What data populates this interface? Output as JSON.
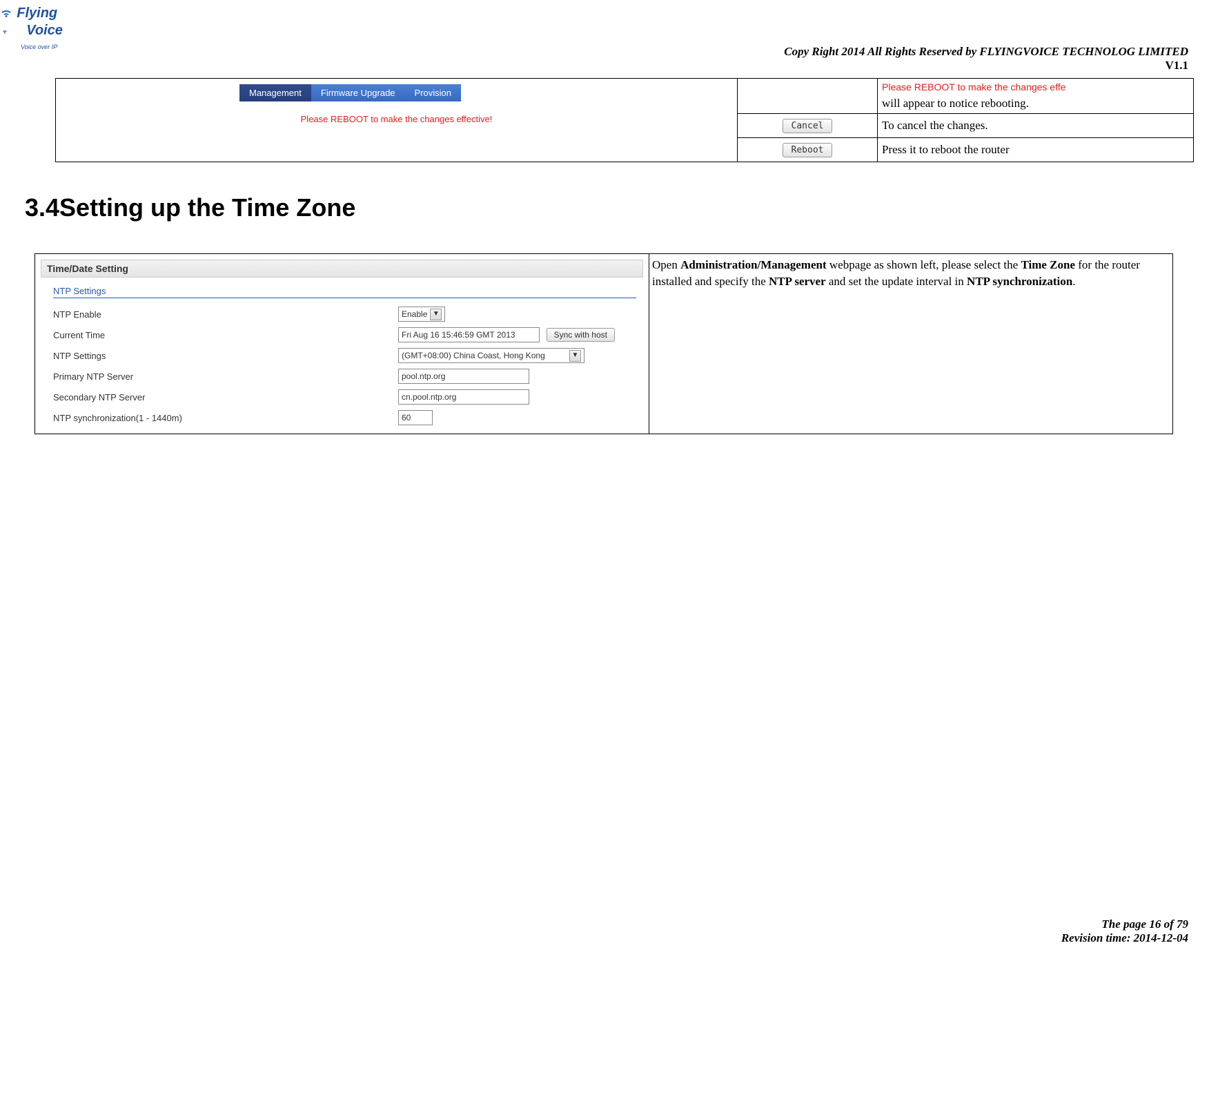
{
  "logo": {
    "flying": "Flying",
    "voice": "Voice",
    "tag": "Voice over IP"
  },
  "header": {
    "copyright": "Copy Right 2014 All Rights Reserved by FLYINGVOICE TECHNOLOG LIMITED",
    "version": "V1.1"
  },
  "top_table": {
    "tabs": {
      "management": "Management",
      "firmware": "Firmware Upgrade",
      "provision": "Provision"
    },
    "reboot_msg_full": "Please REBOOT to make the changes effective!",
    "reboot_msg_trunc": "Please REBOOT to make the changes effe",
    "appear_line": " will appear to notice rebooting.",
    "cancel_btn": "Cancel",
    "cancel_desc": "To cancel the changes.",
    "reboot_btn": "Reboot",
    "reboot_desc": "Press it to reboot the router"
  },
  "section_heading": "3.4Setting up the Time Zone",
  "tz_panel": {
    "title": "Time/Date Setting",
    "section": "NTP Settings",
    "rows": {
      "ntp_enable_label": "NTP Enable",
      "ntp_enable_value": "Enable",
      "current_time_label": "Current Time",
      "current_time_value": "Fri Aug 16 15:46:59 GMT 2013",
      "sync_btn": "Sync with host",
      "ntp_settings_label": "NTP Settings",
      "ntp_settings_value": "(GMT+08:00) China Coast, Hong Kong",
      "primary_label": "Primary NTP Server",
      "primary_value": "pool.ntp.org",
      "secondary_label": "Secondary NTP Server",
      "secondary_value": "cn.pool.ntp.org",
      "sync_interval_label": "NTP synchronization(1 - 1440m)",
      "sync_interval_value": "60"
    }
  },
  "tz_desc": {
    "open": "Open ",
    "admin_bold": "Administration/Management",
    "after_admin": " webpage as shown left, please select the ",
    "time_zone_bold": "Time Zone",
    "after_tz": " for the router installed and specify the ",
    "ntp_server_bold": "NTP server",
    "after_ntp": " and set the update interval in ",
    "ntp_sync_bold": "NTP synchronization",
    "period": "."
  },
  "footer": {
    "page": "The page 16 of 79",
    "revision": "Revision time: 2014-12-04"
  }
}
